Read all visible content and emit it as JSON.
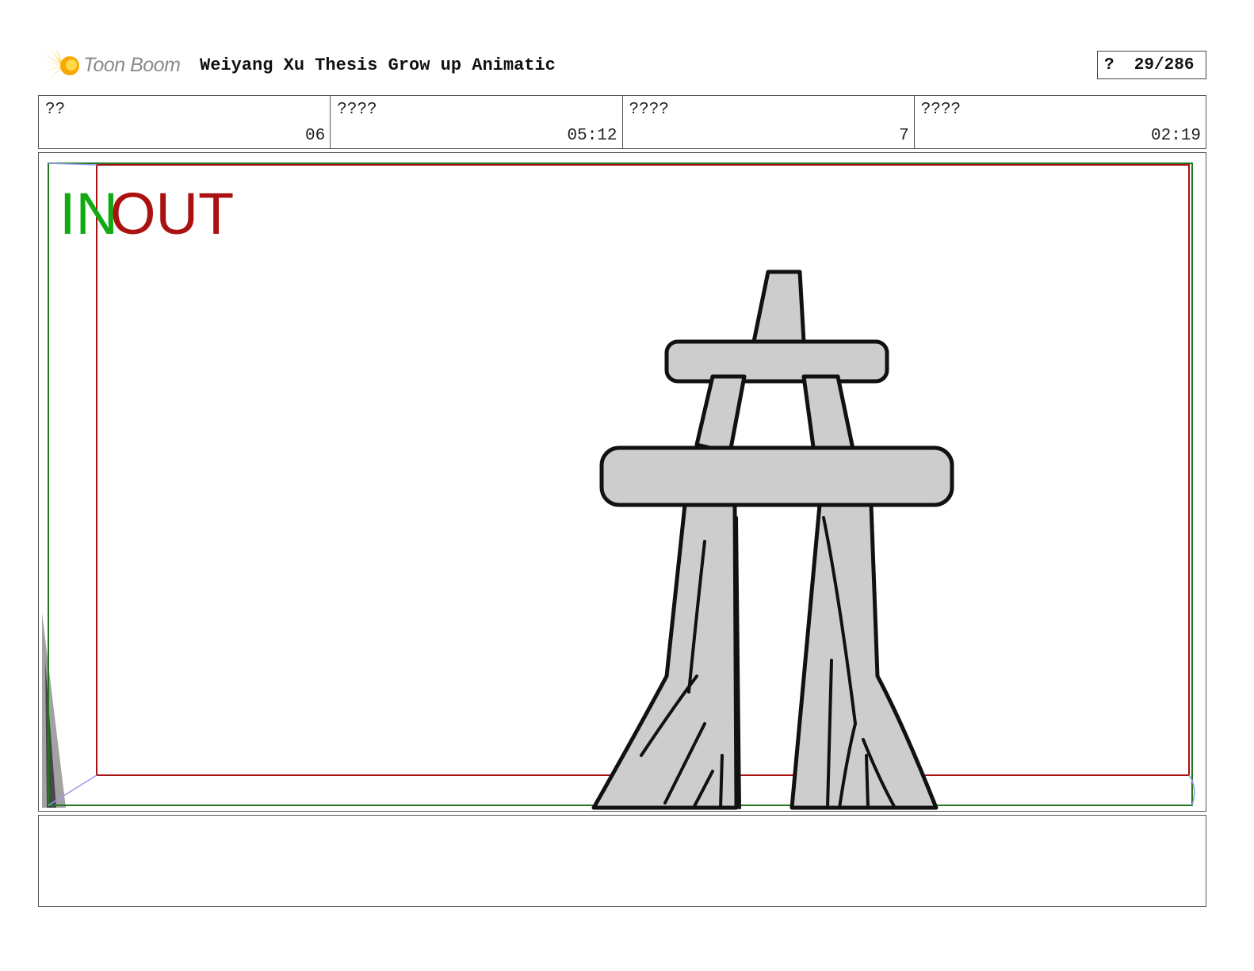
{
  "header": {
    "logo_text": "Toon Boom",
    "title": "Weiyang Xu Thesis Grow up Animatic",
    "page_indicator": "?  29/286"
  },
  "info": [
    {
      "label": "??",
      "value": "06"
    },
    {
      "label": "????",
      "value": "05:12"
    },
    {
      "label": "????",
      "value": "7"
    },
    {
      "label": "????",
      "value": "02:19"
    }
  ],
  "panel": {
    "in_label": "IN",
    "out_label": "OUT",
    "in_color": "#11aa11",
    "out_color": "#aa1111"
  },
  "notes": {
    "text": ""
  }
}
